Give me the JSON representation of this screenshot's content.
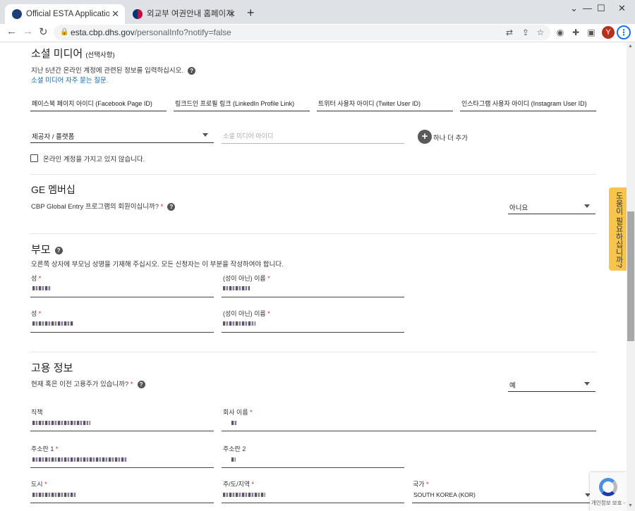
{
  "browser": {
    "tabs": [
      {
        "title": "Official ESTA Application Website",
        "active": true
      },
      {
        "title": "외교부 여권안내 홈페이지",
        "active": false
      }
    ],
    "url_host": "esta.cbp.dhs.gov",
    "url_path": "/personalInfo?notify=false",
    "avatar_letter": "Y"
  },
  "social": {
    "title": "소셜 미디어",
    "optional": "(선택사항)",
    "desc": "지난 5년간 온라인 계정에 관련된 정보를 입력하십시오.",
    "faq_link": "소셜 미디어 자주 묻는 질문.",
    "fields": [
      "페이스북 페이지 아이디 (Facebook Page ID)",
      "링크드인 프로필 링크 (LinkedIn Profile Link)",
      "트위터 사용자 아이디 (Twiter User ID)",
      "인스타그램 사용자 아이디 (Instagram User ID)"
    ],
    "provider_placeholder": "제공자 / 플랫폼",
    "id_placeholder": "소셜 미디어 아이디",
    "add_more": "하나 더 추가",
    "no_account": "온라인 계정을 가지고 있지 않습니다."
  },
  "ge": {
    "title": "GE 멤버십",
    "question": "CBP Global Entry 프로그램의 회원이십니까?",
    "answer": "아니요"
  },
  "parents": {
    "title": "부모",
    "desc": "오른쪽 상자에 부모님 성명을 기재해 주십시오. 모든 신청자는 이 부분을 작성하여야 합니다.",
    "surname_label": "성",
    "given_label": "(성이 아닌) 이름"
  },
  "employment": {
    "title": "고용 정보",
    "question": "현재 혹은 이전 고용주가 있습니까?",
    "answer": "예",
    "job_title": "직책",
    "company": "회사 이름",
    "address1": "주소란 1",
    "address2": "주소란 2",
    "city": "도시",
    "state": "주/도/지역",
    "country_label": "국가",
    "country_value": "SOUTH KOREA (KOR)"
  },
  "help_tab": "도움이 필요하십니까?",
  "recaptcha_text": "개인정보 보호 - 약관",
  "colors": {
    "accent": "#1565a6",
    "required": "#c62828",
    "help_tab": "#f7c54b"
  }
}
